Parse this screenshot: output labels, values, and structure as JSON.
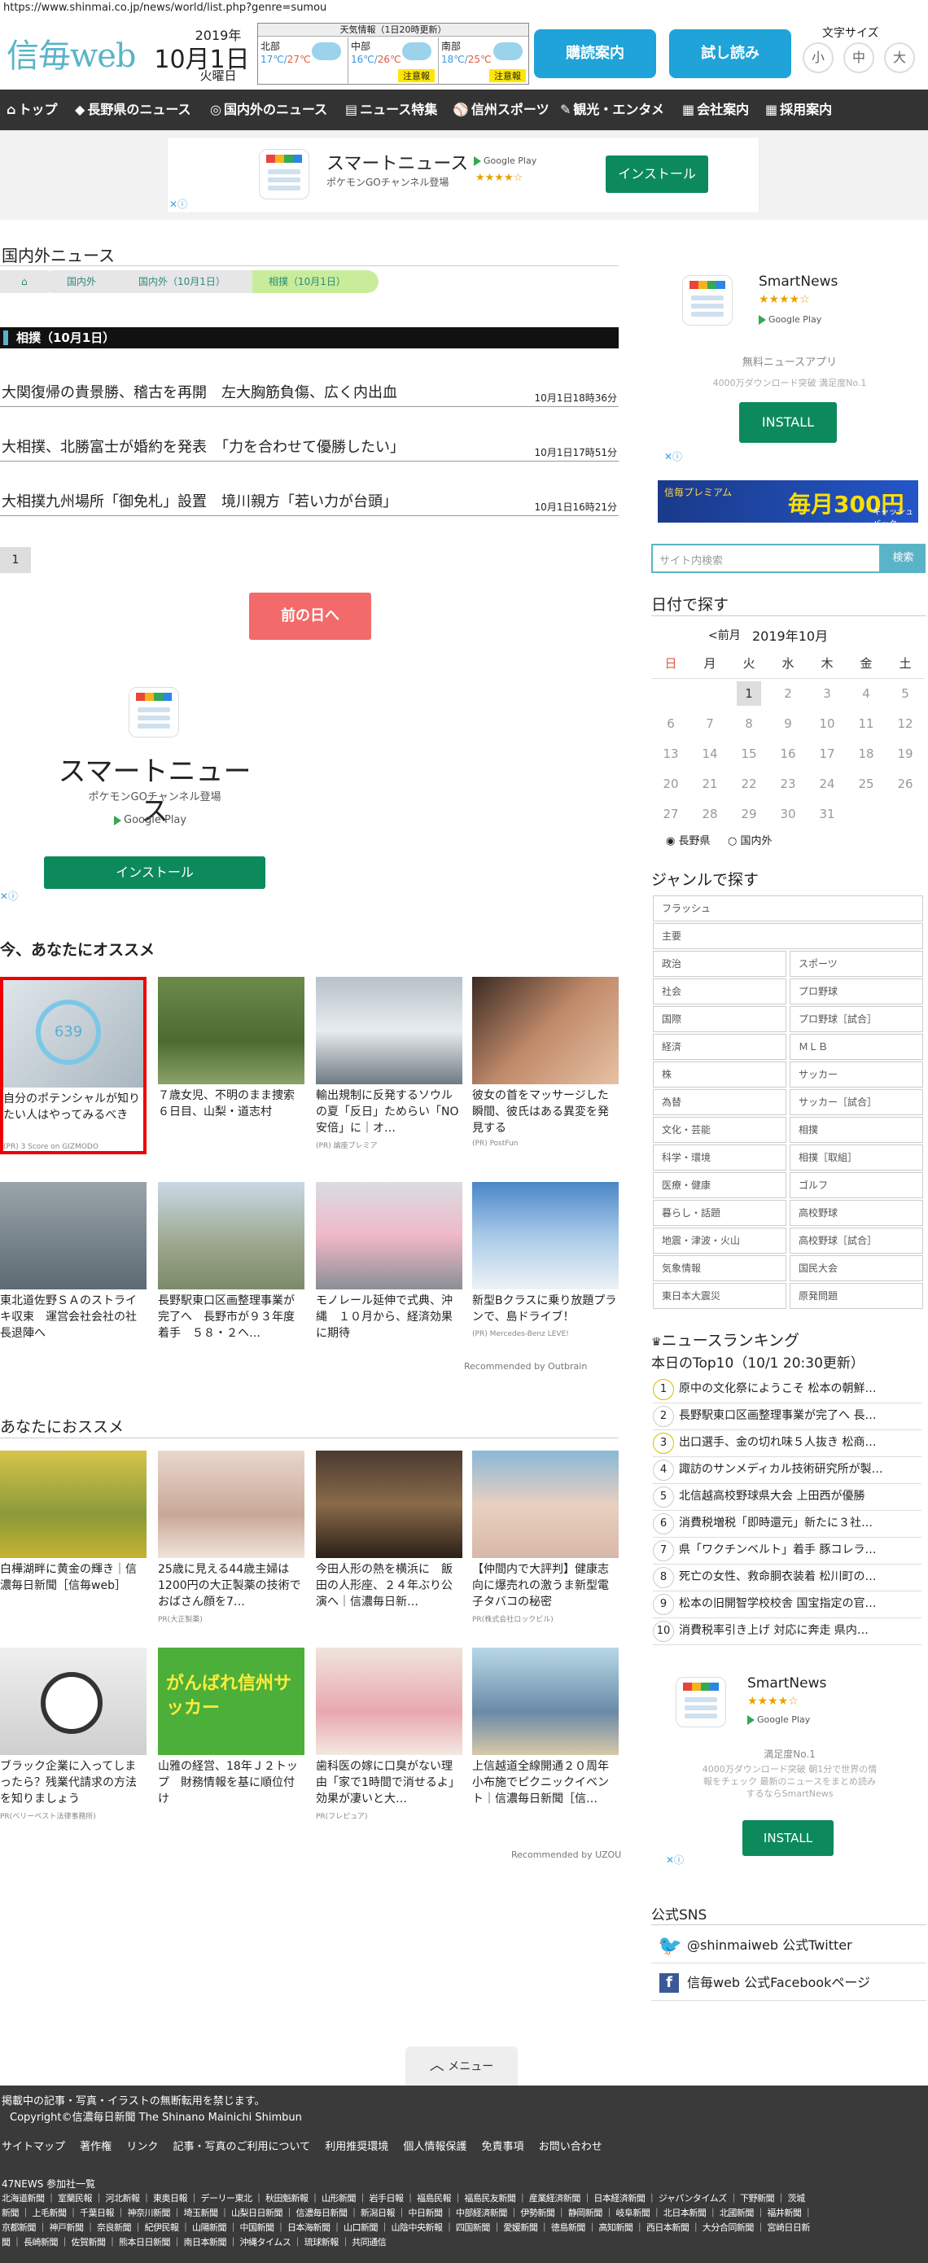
{
  "browser": {
    "url": "https://www.shinmai.co.jp/news/world/list.php?genre=sumou"
  },
  "header": {
    "logo": "信毎web",
    "date_year": "2019年",
    "date_day": "10月1日",
    "date_weekday": "火曜日",
    "weather": {
      "title": "天気情報（1日20時更新）",
      "regions": [
        {
          "name": "北部",
          "high": "17℃",
          "low": "27℃",
          "alert": ""
        },
        {
          "name": "中部",
          "high": "16℃",
          "low": "26℃",
          "alert": "注意報"
        },
        {
          "name": "南部",
          "high": "18℃",
          "low": "25℃",
          "alert": "注意報"
        }
      ]
    },
    "buttons": {
      "subscribe": "購読案内",
      "trial": "試し読み"
    },
    "font_size": {
      "label": "文字サイズ",
      "small": "小",
      "medium": "中",
      "large": "大"
    }
  },
  "nav": [
    {
      "icon": "⌂",
      "label": "トップ"
    },
    {
      "icon": "◆",
      "label": "長野県のニュース"
    },
    {
      "icon": "◎",
      "label": "国内外のニュース"
    },
    {
      "icon": "▤",
      "label": "ニュース特集"
    },
    {
      "icon": "⚾",
      "label": "信州スポーツ"
    },
    {
      "icon": "✎",
      "label": "観光・エンタメ"
    },
    {
      "icon": "▦",
      "label": "会社案内"
    },
    {
      "icon": "▦",
      "label": "採用案内"
    }
  ],
  "top_ad": {
    "name": "スマートニュース",
    "sub": "ポケモンGOチャンネル登場",
    "store": "Google Play",
    "stars": "★★★★☆",
    "button": "インストール"
  },
  "main": {
    "section_title": "国内外ニュース",
    "breadcrumbs": [
      "国内外",
      "国内外（10月1日）",
      "相撲（10月1日）"
    ],
    "list_title": "相撲（10月1日）",
    "news": [
      {
        "title": "大関復帰の貴景勝、稽古を再開　左大胸筋負傷、広く内出血",
        "date": "10月1日18時36分"
      },
      {
        "title": "大相撲、北勝富士が婚約を発表　「力を合わせて優勝したい」",
        "date": "10月1日17時51分"
      },
      {
        "title": "大相撲九州場所「御免札」設置　境川親方「若い力が台頭」",
        "date": "10月1日16時21分"
      }
    ],
    "page": "1",
    "prev_day": "前の日へ",
    "mid_ad": {
      "name": "スマートニュース",
      "sub": "ポケモンGOチャンネル登場",
      "store": "Google Play",
      "button": "インストール"
    },
    "recommend_title": "今、あなたにオススメ",
    "recommend": [
      {
        "caption": "自分のポテンシャルが知りたい人はやってみるべき",
        "source": "(PR) 3 Score on GIZMODO"
      },
      {
        "caption": "７歳女児、不明のまま捜索６日目、山梨・道志村",
        "source": ""
      },
      {
        "caption": "輸出規制に反発するソウルの夏「反日」ためらい「NO安倍」に｜オ…",
        "source": "(PR) 論座プレミア"
      },
      {
        "caption": "彼女の首をマッサージした瞬間、彼氏はある異変を発見する",
        "source": "(PR) PostFun"
      },
      {
        "caption": "東北道佐野ＳＡのストライキ収束　運営会社会社の社長退陣へ",
        "source": ""
      },
      {
        "caption": "長野駅東口区画整理事業が完了へ　長野市が９３年度着手　５８・２ヘ…",
        "source": ""
      },
      {
        "caption": "モノレール延伸で式典、沖縄　１０月から、経済効果に期待",
        "source": ""
      },
      {
        "caption": "新型Bクラスに乗り放題プランで、島ドライブ！",
        "source": "(PR) Mercedes-Benz LEVE!"
      }
    ],
    "outbrain": "Recommended by Outbrain",
    "osusume_title": "あなたにおススメ",
    "osusume": [
      {
        "caption": "白樺湖畔に黄金の輝き｜信濃毎日新聞［信毎web］",
        "source": ""
      },
      {
        "caption": "25歳に見える44歳主婦は1200円の大正製薬の技術でおばさん顔を7…",
        "source": "PR(大正製薬)"
      },
      {
        "caption": "今田人形の熱を横浜に　飯田の人形座、２４年ぶり公演へ｜信濃毎日新…",
        "source": ""
      },
      {
        "caption": "【仲間内で大評判】健康志向に爆売れの激うま新型電子タバコの秘密",
        "source": "PR(株式会社ロックビル)"
      },
      {
        "caption": "ブラック企業に入ってしまったら？残業代請求の方法を知りましょう",
        "source": "PR(ベリーベスト法律事務所)"
      },
      {
        "caption": "山雅の経営、18年Ｊ２トップ　財務情報を基に順位付け",
        "source": ""
      },
      {
        "caption": "歯科医の嫁に口臭がない理由「家で1時間で消せるよ」効果が凄いと大…",
        "source": "PR(フレピュア)"
      },
      {
        "caption": "上信越道全線開通２０周年　小布施でピクニックイベント｜信濃毎日新聞［信…",
        "source": ""
      }
    ],
    "uzou": "Recommended by UZOU",
    "banner_text": "がんばれ信州サッカー"
  },
  "sidebar": {
    "ad": {
      "name": "SmartNews",
      "store": "Google Play",
      "desc": "無料ニュースアプリ",
      "desc2": "4000万ダウンロード突破 満足度No.1",
      "button": "INSTALL"
    },
    "premium_banner": {
      "title": "信毎プレミアム",
      "text": "毎月300円",
      "note": "キャッシュバック"
    },
    "search_placeholder": "サイト内検索",
    "search_button": "検索",
    "calendar": {
      "title": "日付で探す",
      "prev": "<前月",
      "month": "2019年10月",
      "weekdays": [
        "日",
        "月",
        "火",
        "水",
        "木",
        "金",
        "土"
      ],
      "weeks": [
        [
          "",
          "",
          "1",
          "2",
          "3",
          "4",
          "5"
        ],
        [
          "6",
          "7",
          "8",
          "9",
          "10",
          "11",
          "12"
        ],
        [
          "13",
          "14",
          "15",
          "16",
          "17",
          "18",
          "19"
        ],
        [
          "20",
          "21",
          "22",
          "23",
          "24",
          "25",
          "26"
        ],
        [
          "27",
          "28",
          "29",
          "30",
          "31",
          "",
          ""
        ]
      ],
      "radio_nagano": "長野県",
      "radio_world": "国内外"
    },
    "genre_title": "ジャンルで探す",
    "genres_full": [
      "フラッシュ",
      "主要"
    ],
    "genres": [
      [
        "政治",
        "スポーツ"
      ],
      [
        "社会",
        "プロ野球"
      ],
      [
        "国際",
        "プロ野球［試合］"
      ],
      [
        "経済",
        "ＭＬＢ"
      ],
      [
        "株",
        "サッカー"
      ],
      [
        "為替",
        "サッカー［試合］"
      ],
      [
        "文化・芸能",
        "相撲"
      ],
      [
        "科学・環境",
        "相撲［取組］"
      ],
      [
        "医療・健康",
        "ゴルフ"
      ],
      [
        "暮らし・話題",
        "高校野球"
      ],
      [
        "地震・津波・火山",
        "高校野球［試合］"
      ],
      [
        "気象情報",
        "国民大会"
      ],
      [
        "東日本大震災",
        "原発問題"
      ]
    ],
    "ranking_title": "ニュースランキング",
    "ranking_sub": "本日のTop10（10/1 20:30更新）",
    "ranking": [
      "原中の文化祭にようこそ 松本の朝鮮…",
      "長野駅東口区画整理事業が完了へ 長…",
      "出口選手、金の切れ味５人抜き 松商…",
      "諏訪のサンメディカル技術研究所が製…",
      "北信越高校野球県大会 上田西が優勝",
      "消費税増税「即時還元」新たに３社…",
      "県「ワクチンベルト」着手 豚コレラ…",
      "死亡の女性、救命胴衣装着 松川町の…",
      "松本の旧開智学校校舎 国宝指定の官…",
      "消費税率引き上げ 対応に奔走 県内…"
    ],
    "ad2": {
      "name": "SmartNews",
      "store": "Google Play",
      "desc": "満足度No.1",
      "desc2": "4000万ダウンロード突破 朝1分で世界の情報をチェック 最新のニュースをまとめ読みするならSmartNews",
      "button": "INSTALL"
    },
    "sns_title": "公式SNS",
    "sns": [
      "@shinmaiweb 公式Twitter",
      "信毎web 公式Facebookページ"
    ]
  },
  "footer": {
    "menu": "メニュー",
    "notice": "掲載中の記事・写真・イラストの無断転用を禁じます。",
    "copyright": "Copyright©信濃毎日新聞 The Shinano Mainichi Shimbun",
    "links": [
      "サイトマップ",
      "著作権",
      "リンク",
      "記事・写真のご利用について",
      "利用推奨環境",
      "個人情報保護",
      "免責事項",
      "お問い合わせ"
    ],
    "network_title": "47NEWS 参加社一覧",
    "network_line1": "北海道新聞 ｜ 室蘭民報 ｜ 河北新報 ｜ 東奥日報 ｜ デーリー東北 ｜ 秋田魁新報 ｜ 山形新聞 ｜ 岩手日報 ｜ 福島民報 ｜ 福島民友新聞 ｜ 産業経済新聞 ｜ 日本経済新聞 ｜ ジャパンタイムズ ｜ 下野新聞 ｜ 茨城",
    "network_line2": "新聞 ｜ 上毛新聞 ｜ 千葉日報 ｜ 神奈川新聞 ｜ 埼玉新聞 ｜ 山梨日日新聞 ｜ 信濃毎日新聞 ｜ 新潟日報 ｜ 中日新聞 ｜ 中部経済新聞 ｜ 伊勢新聞 ｜ 静岡新聞 ｜ 岐阜新聞 ｜ 北日本新聞 ｜ 北國新聞 ｜ 福井新聞 ｜",
    "network_line3": "京都新聞 ｜ 神戸新聞 ｜ 奈良新聞 ｜ 紀伊民報 ｜ 山陽新聞 ｜ 中国新聞 ｜ 日本海新聞 ｜ 山口新聞 ｜ 山陰中央新報 ｜ 四国新聞 ｜ 愛媛新聞 ｜ 徳島新聞 ｜ 高知新聞 ｜ 西日本新聞 ｜ 大分合同新聞 ｜ 宮崎日日新",
    "network_line4": "聞 ｜ 長崎新聞 ｜ 佐賀新聞 ｜ 熊本日日新聞 ｜ 南日本新聞 ｜ 沖縄タイムス ｜ 琉球新報 ｜ 共同通信"
  }
}
